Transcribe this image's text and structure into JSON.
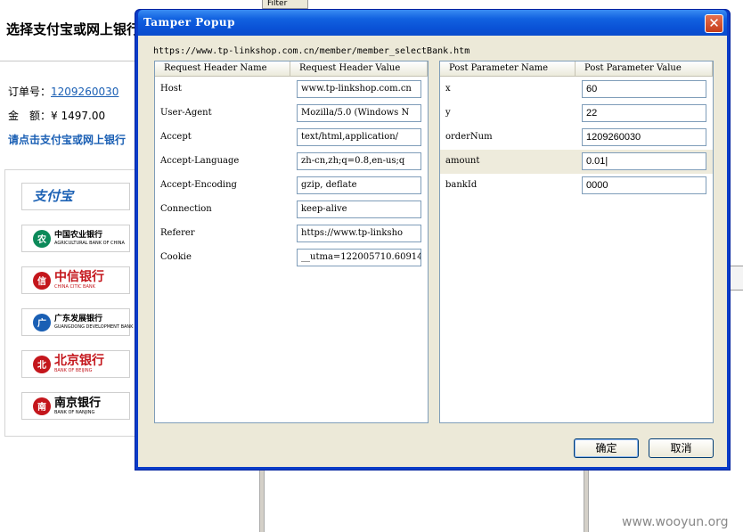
{
  "background_page": {
    "heading": "选择支付宝或网上银行",
    "order_label": "订单号：",
    "order_number": "1209260030",
    "amount_label": "金　额：",
    "amount_value": "¥ 1497.00",
    "hint": "请点击支付宝或网上银行",
    "filter_tab": "Filter",
    "banks": [
      {
        "name": "支付宝",
        "en": "",
        "color": "#1e63b5"
      },
      {
        "name": "中国农业银行",
        "en": "AGRICULTURAL BANK OF CHINA",
        "color": "#0c8a5a"
      },
      {
        "name": "中信银行",
        "en": "CHINA CITIC BANK",
        "color": "#c4161c"
      },
      {
        "name": "广东发展银行",
        "en": "GUANGDONG DEVELOPMENT BANK",
        "color": "#1a5fb4"
      },
      {
        "name": "北京银行",
        "en": "BANK OF BEIJING",
        "color": "#c4161c"
      },
      {
        "name": "南京银行",
        "en": "BANK OF NANJING",
        "color": "#c4161c"
      }
    ],
    "watermark": "www.wooyun.org"
  },
  "popup": {
    "title": "Tamper Popup",
    "url": "https://www.tp-linkshop.com.cn/member/member_selectBank.htm",
    "headers_table": {
      "col_name": "Request Header Name",
      "col_value": "Request Header Value",
      "rows": [
        {
          "name": "Host",
          "value": "www.tp-linkshop.com.cn"
        },
        {
          "name": "User-Agent",
          "value": "Mozilla/5.0 (Windows N"
        },
        {
          "name": "Accept",
          "value": "text/html,application/"
        },
        {
          "name": "Accept-Language",
          "value": "zh-cn,zh;q=0.8,en-us;q"
        },
        {
          "name": "Accept-Encoding",
          "value": "gzip, deflate"
        },
        {
          "name": "Connection",
          "value": "keep-alive"
        },
        {
          "name": "Referer",
          "value": "https://www.tp-linksho"
        },
        {
          "name": "Cookie",
          "value": "__utma=122005710.60914"
        }
      ]
    },
    "post_table": {
      "col_name": "Post Parameter Name",
      "col_value": "Post Parameter Value",
      "rows": [
        {
          "name": "x",
          "value": "60"
        },
        {
          "name": "y",
          "value": "22"
        },
        {
          "name": "orderNum",
          "value": "1209260030"
        },
        {
          "name": "amount",
          "value": "0.01|"
        },
        {
          "name": "bankId",
          "value": "0000"
        }
      ]
    },
    "ok_label": "确定",
    "cancel_label": "取消",
    "close_icon": "close-icon"
  }
}
